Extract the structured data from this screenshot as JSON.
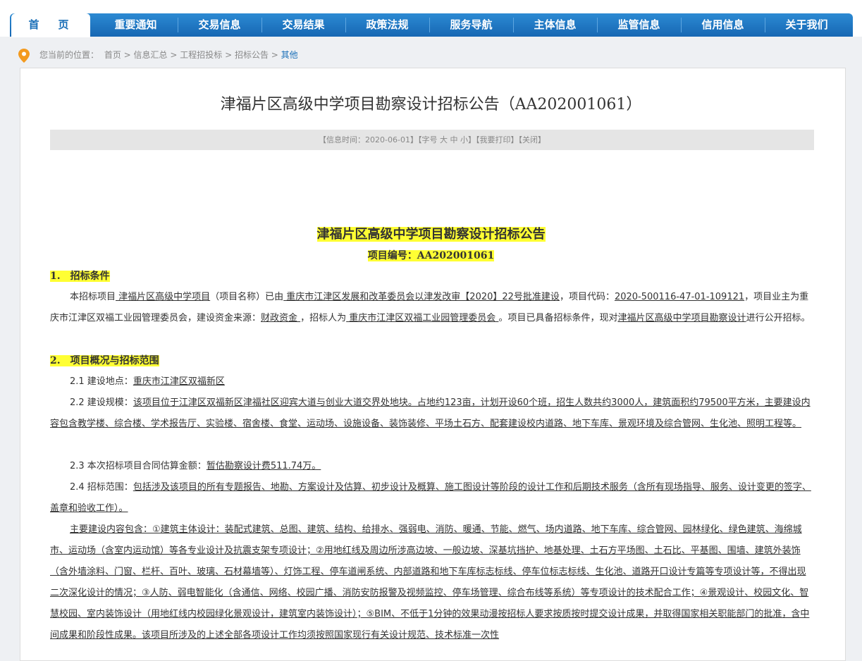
{
  "nav": {
    "items": [
      "首　页",
      "重要通知",
      "交易信息",
      "交易结果",
      "政策法规",
      "服务导航",
      "主体信息",
      "监管信息",
      "信用信息",
      "关于我们"
    ]
  },
  "breadcrumb": {
    "prefix": "您当前的位置：",
    "items": [
      "首页",
      "信息汇总",
      "工程招投标",
      "招标公告"
    ],
    "current": "其他",
    "sep": " > "
  },
  "page_title": "津福片区高级中学项目勘察设计招标公告（AA202001061）",
  "info_bar": {
    "time": "【信息时间：2020-06-01】",
    "font_prefix": "【字号",
    "font_big": "大",
    "font_mid": "中",
    "font_small": "小】",
    "print": "【我要打印】",
    "close": "【关闭】"
  },
  "doc": {
    "title": "津福片区高级中学项目勘察设计招标公告",
    "number": "项目编号：AA202001061",
    "s1_heading": "1.　招标条件",
    "s1_p1": "本招标项目",
    "s1_u1": " 津福片区高级中学项目",
    "s1_p2": "（项目名称）已由",
    "s1_u2": " 重庆市江津区发展和改革委员会以津发改审【2020】22号批准建设",
    "s1_p3": "，项目代码：",
    "s1_u3": "2020-500116-47-01-109121",
    "s1_p4": "，项目业主为重庆市江津区双福工业园管理委员会，建设资金来源：",
    "s1_u4": "财政资金 ",
    "s1_p5": "，招标人为",
    "s1_u5": " 重庆市江津区双福工业园管理委员会 ",
    "s1_p6": "。项目已具备招标条件，现对",
    "s1_u6": "津福片区高级中学项目勘察设计",
    "s1_p7": "进行公开招标。",
    "s2_heading": "2.　项目概况与招标范围",
    "s2_1_label": "2.1 建设地点：",
    "s2_1_value": "重庆市江津区双福新区",
    "s2_2_label": "2.2 建设规模：",
    "s2_2_value": "该项目位于江津区双福新区津福社区迎宾大道与创业大道交界处地块。占地约123亩，计划开设60个班，招生人数共约3000人，建筑面积约79500平方米，主要建设内容包含教学楼、综合楼、学术报告厅、实验楼、宿舍楼、食堂、运动场、设施设备、装饰装修、平场土石方、配套建设校内道路、地下车库、景观环境及综合管网、生化池、照明工程等。",
    "s2_3_label": "2.3 本次招标项目合同估算金额：",
    "s2_3_value": "暂估勘察设计费511.74万。",
    "s2_4_label": "2.4 招标范围：",
    "s2_4_value": "包括涉及该项目的所有专题报告、地勘、方案设计及估算、初步设计及概算、施工图设计等阶段的设计工作和后期技术服务（含所有现场指导、服务、设计变更的签字、盖章和验收工作）。",
    "s2_5_value": "主要建设内容包含：①建筑主体设计：装配式建筑、总图、建筑、结构、给排水、强弱电、消防、暖通、节能、燃气、场内道路、地下车库、综合管网、园林绿化、绿色建筑、海绵城市、运动场（含室内运动馆）等各专业设计及抗震支架专项设计；②用地红线及周边所涉高边坡、一般边坡、深基坑挡护、地基处理、土石方平场图、土石比、平基图、围墙、建筑外装饰（含外墙涂料、门窗、栏杆、百叶、玻璃、石材幕墙等）、灯饰工程、停车道闸系统、内部道路和地下车库标志标线、停车位标志标线、生化池、道路开口设计专篇等专项设计等，不得出现二次深化设计的情况；③人防、弱电智能化（含通信、网络、校园广播、消防安防报警及视频监控、停车场管理、综合布线等系统）等专项设计的技术配合工作；④景观设计、校园文化、智慧校园、室内装饰设计（用地红线内校园绿化景观设计，建筑室内装饰设计）；⑤BIM、不低于1分钟的效果动漫按招标人要求按质按时提交设计成果，并取得国家相关职能部门的批准，含中间成果和阶段性成果。该项目所涉及的上述全部各项设计工作均须按照国家现行有关设计规范、技术标准一次性"
  }
}
